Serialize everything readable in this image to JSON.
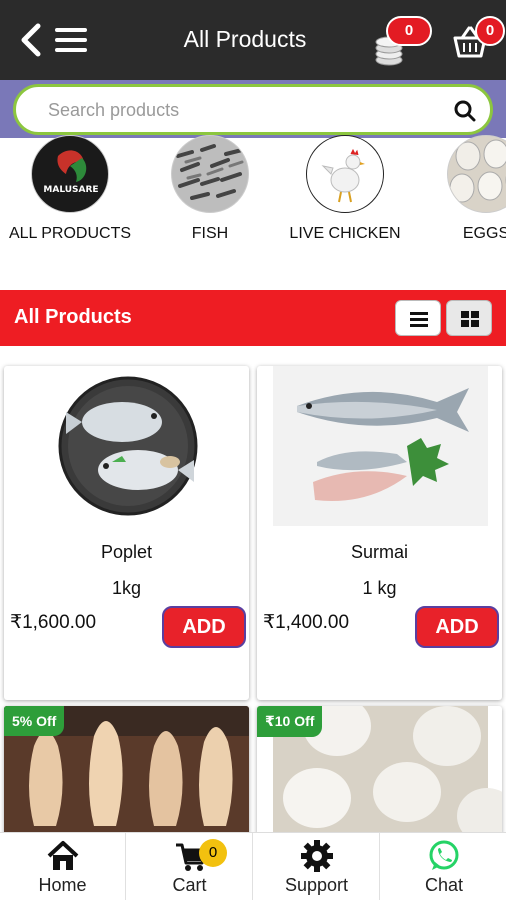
{
  "header": {
    "title": "All Products",
    "coin_count": "0",
    "cart_count": "0"
  },
  "search": {
    "placeholder": "Search products"
  },
  "categories": [
    {
      "label": "ALL PRODUCTS",
      "logo_text": "MALUSARE"
    },
    {
      "label": "FISH"
    },
    {
      "label": "LIVE CHICKEN"
    },
    {
      "label": "EGGS"
    }
  ],
  "section": {
    "title": "All Products"
  },
  "products": [
    {
      "name": "Poplet",
      "qty": "1kg",
      "price": "₹1,600.00",
      "add_label": "ADD"
    },
    {
      "name": "Surmai",
      "qty": "1 kg",
      "price": "₹1,400.00",
      "add_label": "ADD"
    },
    {
      "badge": "5% Off"
    },
    {
      "badge": "₹10 Off"
    }
  ],
  "bottom_nav": {
    "home": "Home",
    "cart": "Cart",
    "cart_count": "0",
    "support": "Support",
    "chat": "Chat"
  },
  "colors": {
    "appbar": "#2b2b2b",
    "search_band": "#7a78b8",
    "search_border": "#8cc63f",
    "section_red": "#ee1d23",
    "add_red": "#e8222a",
    "offer_green": "#2e9e3a",
    "chat_green": "#25d366"
  }
}
